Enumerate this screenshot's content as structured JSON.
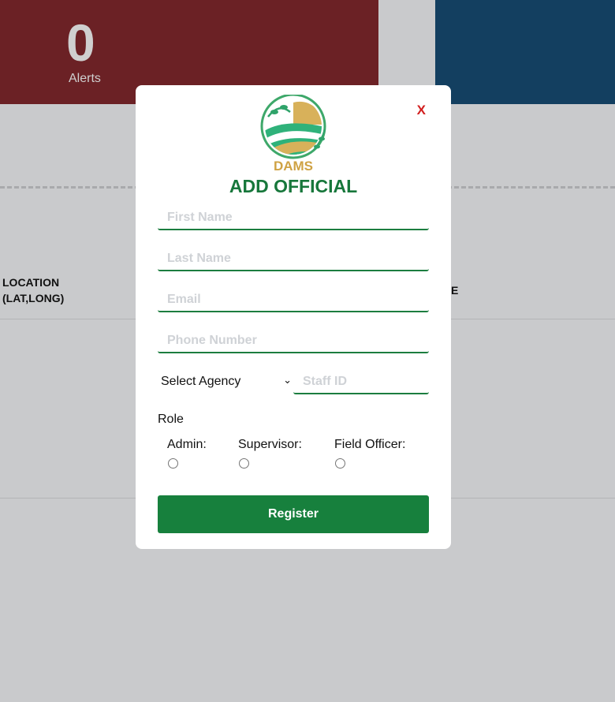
{
  "background": {
    "alerts_count": "0",
    "alerts_label": "Alerts",
    "table_header_location": "LOCATION\n(LAT,LONG)",
    "table_header_partial": "E"
  },
  "modal": {
    "close_label": "X",
    "logo_text": "DAMS",
    "title": "ADD OFFICIAL",
    "first_name_placeholder": "First Name",
    "last_name_placeholder": "Last Name",
    "email_placeholder": "Email",
    "phone_placeholder": "Phone Number",
    "agency_select": "Select Agency",
    "staff_id_placeholder": "Staff ID",
    "role_label": "Role",
    "roles": [
      "Admin:",
      "Supervisor:",
      "Field Officer:"
    ],
    "register_label": "Register"
  },
  "colors": {
    "accent_green": "#17803d",
    "title_green": "#17773b",
    "close_red": "#d21f1f",
    "logo_gold": "#cfa244"
  }
}
